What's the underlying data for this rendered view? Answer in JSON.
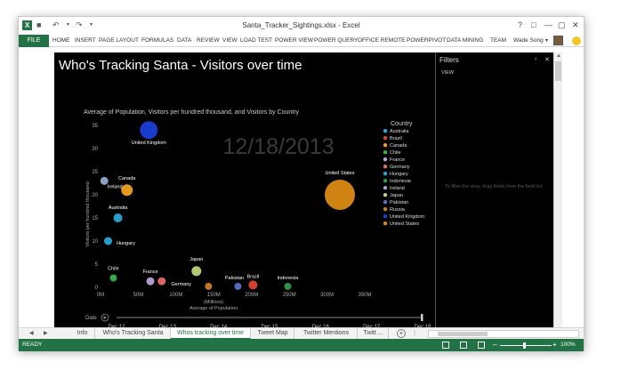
{
  "window": {
    "title": "Santa_Tracker_Sightings.xlsx - Excel",
    "controls": [
      "?",
      "□",
      "—",
      "▢",
      "✕"
    ]
  },
  "ribbon": {
    "file_label": "FILE",
    "tabs": [
      "HOME",
      "INSERT",
      "PAGE LAYOUT",
      "FORMULAS",
      "DATA",
      "REVIEW",
      "VIEW",
      "LOAD TEST",
      "POWER VIEW",
      "POWER QUERY",
      "OFFICE REMOTE",
      "POWERPIVOT",
      "DATA MINING",
      "TEAM"
    ],
    "user_name": "Wade Song"
  },
  "power_view": {
    "title": "Who's Tracking Santa - Visitors over time",
    "chart_title": "Average of Population, Visitors per hundred thousand, and Visitors by Country"
  },
  "filters": {
    "title": "Filters",
    "view_label": "VIEW",
    "hint": "To filter the view, drag fields from the field list."
  },
  "chart_data": {
    "type": "scatter",
    "title": "Average of Population, Visitors per hundred thousand, and Visitors by Country",
    "xlabel": "(Millions)\nAverage of Population",
    "x_unit_line1": "(Millions)",
    "x_unit_line2": "Average of Population",
    "ylabel": "Visitors per hundred thousand",
    "xlim": [
      0,
      350
    ],
    "ylim": [
      0,
      35
    ],
    "x_ticks": [
      "0M",
      "50M",
      "100M",
      "150M",
      "200M",
      "250M",
      "300M",
      "350M"
    ],
    "x_tick_values": [
      0,
      50,
      100,
      150,
      200,
      250,
      300,
      350
    ],
    "y_ticks": [
      "0",
      "5",
      "10",
      "15",
      "20",
      "25",
      "30",
      "35"
    ],
    "y_tick_values": [
      0,
      5,
      10,
      15,
      20,
      25,
      30,
      35
    ],
    "watermark": "12/18/2013",
    "legend_title": "Country",
    "legend_position": "right",
    "series": [
      {
        "name": "Australia",
        "x": 23,
        "y": 15,
        "size": 5,
        "color": "#2aa7d8"
      },
      {
        "name": "Brazil",
        "x": 202,
        "y": 0.5,
        "size": 5,
        "color": "#e0452f"
      },
      {
        "name": "Canada",
        "x": 35,
        "y": 21,
        "size": 6.5,
        "color": "#f0a020"
      },
      {
        "name": "Chile",
        "x": 17,
        "y": 2,
        "size": 4,
        "color": "#3cb34a"
      },
      {
        "name": "France",
        "x": 66,
        "y": 1.3,
        "size": 4.5,
        "color": "#b9a0d8"
      },
      {
        "name": "Germany",
        "x": 81,
        "y": 1.3,
        "size": 4.5,
        "color": "#e46c6c"
      },
      {
        "name": "Hungary",
        "x": 10,
        "y": 10,
        "size": 4.5,
        "color": "#2aa7d8"
      },
      {
        "name": "Indonesia",
        "x": 248,
        "y": 0.2,
        "size": 4,
        "color": "#2d9a4a"
      },
      {
        "name": "Ireland",
        "x": 5,
        "y": 23,
        "size": 4.5,
        "color": "#8fa8c8"
      },
      {
        "name": "Japan",
        "x": 127,
        "y": 3.5,
        "size": 5.5,
        "color": "#bcd47a"
      },
      {
        "name": "Pakistan",
        "x": 182,
        "y": 0.2,
        "size": 4,
        "color": "#5a70c8"
      },
      {
        "name": "Russia",
        "x": 143,
        "y": 0.2,
        "size": 4,
        "color": "#d07a2a"
      },
      {
        "name": "United Kingdom",
        "x": 64,
        "y": 34,
        "size": 10,
        "color": "#1a3fd8"
      },
      {
        "name": "United States",
        "x": 317,
        "y": 20,
        "size": 17,
        "color": "#d98a14"
      }
    ],
    "point_labels": [
      {
        "name": "United Kingdom",
        "dx": 0,
        "dy": 14
      },
      {
        "name": "Canada",
        "dx": 0,
        "dy": -14
      },
      {
        "name": "Ireland",
        "dx": 12,
        "dy": 6
      },
      {
        "name": "Australia",
        "dx": 0,
        "dy": -12
      },
      {
        "name": "Hungary",
        "dx": 20,
        "dy": 2
      },
      {
        "name": "United States",
        "dx": 0,
        "dy": -25
      },
      {
        "name": "Japan",
        "dx": 0,
        "dy": -14
      },
      {
        "name": "Chile",
        "dx": 0,
        "dy": -11
      },
      {
        "name": "France",
        "dx": 0,
        "dy": -11
      },
      {
        "name": "Germany",
        "dx": 22,
        "dy": 3
      },
      {
        "name": "Pakistan",
        "dx": -4,
        "dy": -10
      },
      {
        "name": "Brazil",
        "dx": 0,
        "dy": -10
      },
      {
        "name": "Indonesia",
        "dx": 0,
        "dy": -10
      }
    ],
    "play_axis": {
      "label": "Date",
      "ticks": [
        "Dec 12",
        "Dec 13",
        "Dec 14",
        "Dec 15",
        "Dec 16",
        "Dec 17",
        "Dec 18"
      ]
    }
  },
  "sheet_tabs": {
    "items": [
      "Info",
      "Who's Tracking Santa",
      "Whos tracking over time",
      "Tweet Map",
      "Twitter Mentions",
      "Twitt ..."
    ],
    "active_index": 2
  },
  "status_bar": {
    "ready": "READY",
    "zoom": "100%"
  }
}
